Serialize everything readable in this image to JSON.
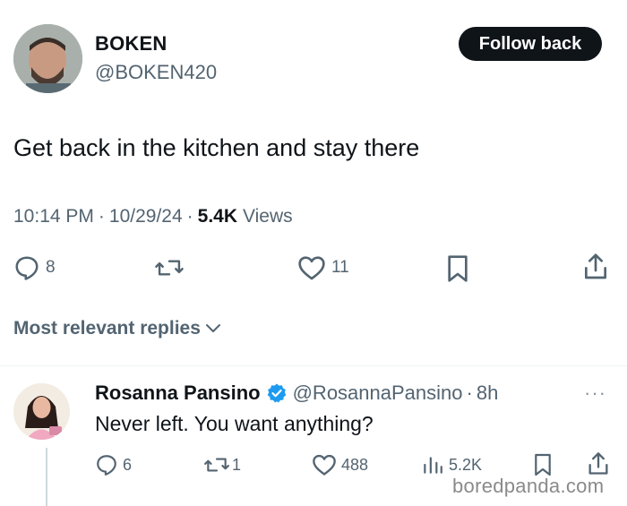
{
  "tweet": {
    "author_name": "BOKEN",
    "author_handle": "@BOKEN420",
    "follow_label": "Follow back",
    "text": "Get back in the kitchen and stay there",
    "time": "10:14 PM",
    "separator": "·",
    "date": "10/29/24",
    "views_count": "5.4K",
    "views_label": "Views",
    "replies": "8",
    "likes": "11"
  },
  "sort": {
    "label": "Most relevant replies"
  },
  "reply": {
    "author_name": "Rosanna Pansino",
    "author_handle": "@RosannaPansino",
    "separator": "·",
    "age": "8h",
    "more": "···",
    "text": "Never left. You want anything?",
    "replies": "6",
    "reposts": "1",
    "likes": "488",
    "views": "5.2K"
  },
  "colors": {
    "primary_text": "#0f1419",
    "secondary_text": "#536471",
    "button_bg": "#0f1419",
    "verified": "#1d9bf0"
  },
  "watermark": "boredpanda.com"
}
